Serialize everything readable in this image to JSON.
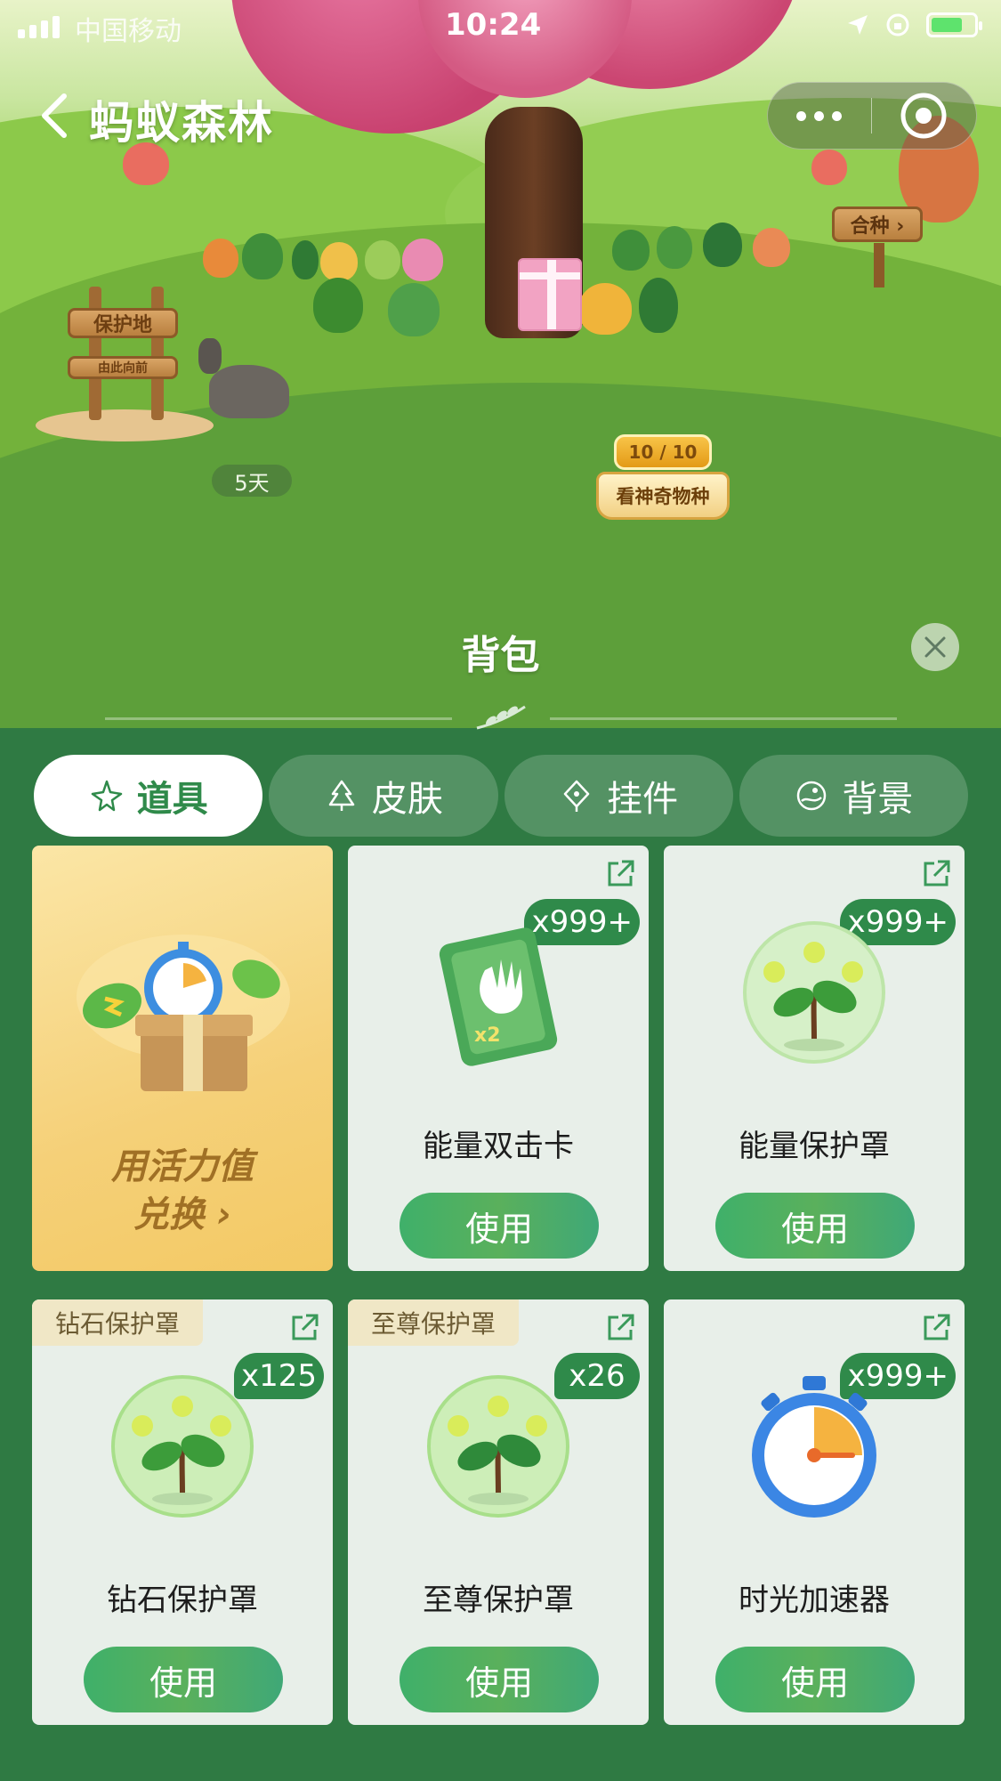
{
  "status_bar": {
    "carrier": "中国移动",
    "time": "10:24"
  },
  "nav": {
    "title": "蚂蚁森林"
  },
  "scene": {
    "protection_sign": "保护地",
    "protection_sub": "由此向前",
    "animal_days": "5天",
    "merge_button": "合种 ›",
    "species_count": "10 / 10",
    "species_label": "看神奇物种"
  },
  "backpack": {
    "title": "背包",
    "tabs": [
      {
        "label": "道具",
        "icon": "star-sparkle-icon",
        "active": true
      },
      {
        "label": "皮肤",
        "icon": "tree-icon",
        "active": false
      },
      {
        "label": "挂件",
        "icon": "diamond-tag-icon",
        "active": false
      },
      {
        "label": "背景",
        "icon": "scenery-circle-icon",
        "active": false
      }
    ],
    "exchange_card": {
      "line1": "用活力值",
      "line2": "兑换 ›"
    },
    "items": [
      {
        "name": "能量双击卡",
        "count": "x999+",
        "tag": "",
        "icon": "double-hit-card-icon",
        "button": "使用"
      },
      {
        "name": "能量保护罩",
        "count": "x999+",
        "tag": "",
        "icon": "energy-shield-sprout-icon",
        "button": "使用"
      },
      {
        "name": "钻石保护罩",
        "count": "x125",
        "tag": "钻石保护罩",
        "icon": "diamond-shield-sprout-icon",
        "button": "使用"
      },
      {
        "name": "至尊保护罩",
        "count": "x26",
        "tag": "至尊保护罩",
        "icon": "supreme-shield-sprout-icon",
        "button": "使用"
      },
      {
        "name": "时光加速器",
        "count": "x999+",
        "tag": "",
        "icon": "stopwatch-icon",
        "button": "使用"
      }
    ]
  },
  "colors": {
    "panel_bg": "#2f7a43",
    "accent_green": "#2f8a4a",
    "card_bg": "#e8efe9",
    "exchange_gold": "#f5d078"
  }
}
